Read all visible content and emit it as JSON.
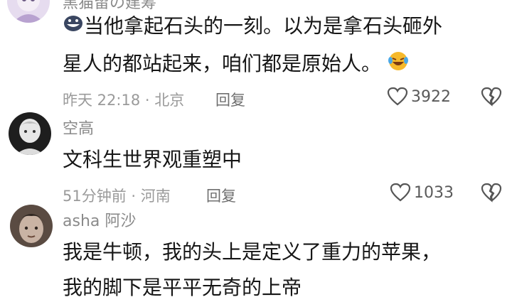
{
  "comments": [
    {
      "username": "黑猫留の建筹",
      "text_lines": [
        "当他拿起石头的一刻。以为是拿石头砸外",
        "星人的都站起来，咱们都是原始人。"
      ],
      "time": "昨天 22:18",
      "location": "北京",
      "reply_label": "回复",
      "likes": "3922",
      "leading_emoji": "grin-emoji-icon",
      "trailing_emoji": "laugh-cry-emoji-icon"
    },
    {
      "username": "空高",
      "text_lines": [
        "文科生世界观重塑中"
      ],
      "time": "51分钟前",
      "location": "河南",
      "reply_label": "回复",
      "likes": "1033"
    },
    {
      "username": "asha 阿沙",
      "text_lines": [
        "我是牛顿，我的头上是定义了重力的苹果，",
        "我的脚下是平平无奇的上帝"
      ],
      "time": "",
      "location": ""
    }
  ],
  "meta_separator": " · ",
  "colors": {
    "text": "#161616",
    "meta": "#9a9a9a",
    "username": "#8a8a8a"
  }
}
